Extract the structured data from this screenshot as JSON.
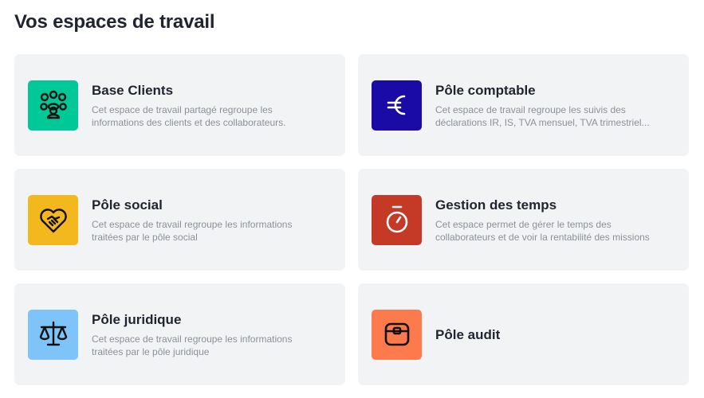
{
  "page": {
    "title": "Vos espaces de travail"
  },
  "workspaces": [
    {
      "title": "Base Clients",
      "description": "Cet espace de travail partagé regroupe les informations des clients et des collaborateurs.",
      "icon": "people-group-icon",
      "color": "#00c896"
    },
    {
      "title": "Pôle comptable",
      "description": "Cet espace de travail regroupe les suivis des déclarations IR, IS, TVA mensuel, TVA trimestriel...",
      "icon": "euro-icon",
      "color": "#1a0aa6"
    },
    {
      "title": "Pôle social",
      "description": "Cet espace de travail regroupe les informations traitées par le pôle social",
      "icon": "handshake-heart-icon",
      "color": "#f4b81f"
    },
    {
      "title": "Gestion des temps",
      "description": "Cet espace permet de gérer le temps des collaborateurs et de voir la rentabilité des missions",
      "icon": "stopwatch-icon",
      "color": "#c53a27"
    },
    {
      "title": "Pôle juridique",
      "description": "Cet espace de travail regroupe les informations traitées par le pôle juridique",
      "icon": "scales-icon",
      "color": "#7fc4f8"
    },
    {
      "title": "Pôle audit",
      "description": "",
      "icon": "briefcase-icon",
      "color": "#fd7a4d"
    }
  ]
}
